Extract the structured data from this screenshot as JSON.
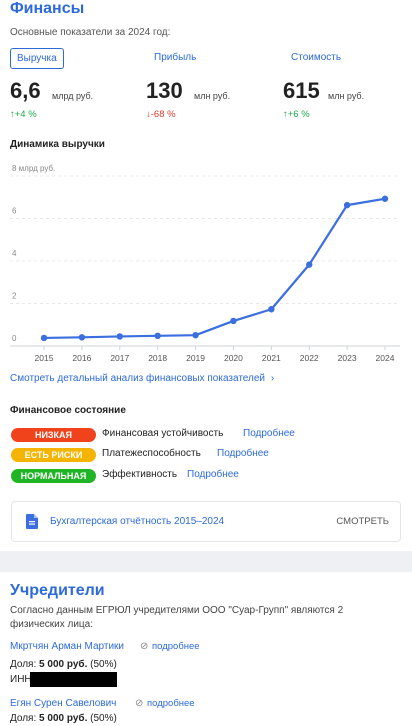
{
  "finances": {
    "title": "Финансы",
    "subtitle": "Основные показатели за 2024 год:",
    "tabs": [
      "Выручка",
      "Прибыль",
      "Стоимость"
    ],
    "metrics": [
      {
        "value": "6,6",
        "unit": "млрд руб.",
        "delta": "↑+4 %",
        "trend": "up"
      },
      {
        "value": "130",
        "unit": "млн руб.",
        "delta": "↓-68 %",
        "trend": "down"
      },
      {
        "value": "615",
        "unit": "млн руб.",
        "delta": "↑+6 %",
        "trend": "up"
      }
    ],
    "chart_title": "Динамика выручки",
    "analysis_link": "Смотреть детальный анализ финансовых показателей",
    "state_title": "Финансовое состояние",
    "states": [
      {
        "badge": "НИЗКАЯ",
        "label": "Финансовая устойчивость",
        "more": "Подробнее",
        "color": "#f0431c"
      },
      {
        "badge": "ЕСТЬ РИСКИ",
        "label": "Платежеспособность",
        "more": "Подробнее",
        "color": "#f4b400"
      },
      {
        "badge": "НОРМАЛЬНАЯ",
        "label": "Эффективность",
        "more": "Подробнее",
        "color": "#22b427"
      }
    ],
    "report_label": "Бухгалтерская отчётность 2015–2024",
    "report_action": "СМОТРЕТЬ"
  },
  "chart_data": {
    "type": "line",
    "title": "Динамика выручки",
    "ylabel": "8 млрд руб.",
    "x": [
      "2015",
      "2016",
      "2017",
      "2018",
      "2019",
      "2020",
      "2021",
      "2022",
      "2023",
      "2024"
    ],
    "y_ticks": [
      "8 млрд руб.",
      "6",
      "4",
      "2",
      "0"
    ],
    "series": [
      {
        "values": [
          0.05,
          0.08,
          0.12,
          0.15,
          0.18,
          0.85,
          1.4,
          3.5,
          6.3,
          6.6
        ],
        "color": "#3b6fe0"
      }
    ],
    "ylim": [
      0,
      8
    ],
    "grid": true
  },
  "owners": {
    "title": "Учредители",
    "intro": "Согласно данным ЕГРЮЛ учредителями ООО \"Суар-Групп\" являются 2 физических лица:",
    "list": [
      {
        "name": "Мкртчян Арман Мартики",
        "more": "подробнее",
        "share_label": "Доля:",
        "share_value": "5 000 руб.",
        "share_pct": "(50%)",
        "inn_label": "ИНН"
      },
      {
        "name": "Егян Сурен Савелович",
        "more": "подробнее",
        "share_label": "Доля:",
        "share_value": "5 000 руб.",
        "share_pct": "(50%)"
      }
    ]
  }
}
